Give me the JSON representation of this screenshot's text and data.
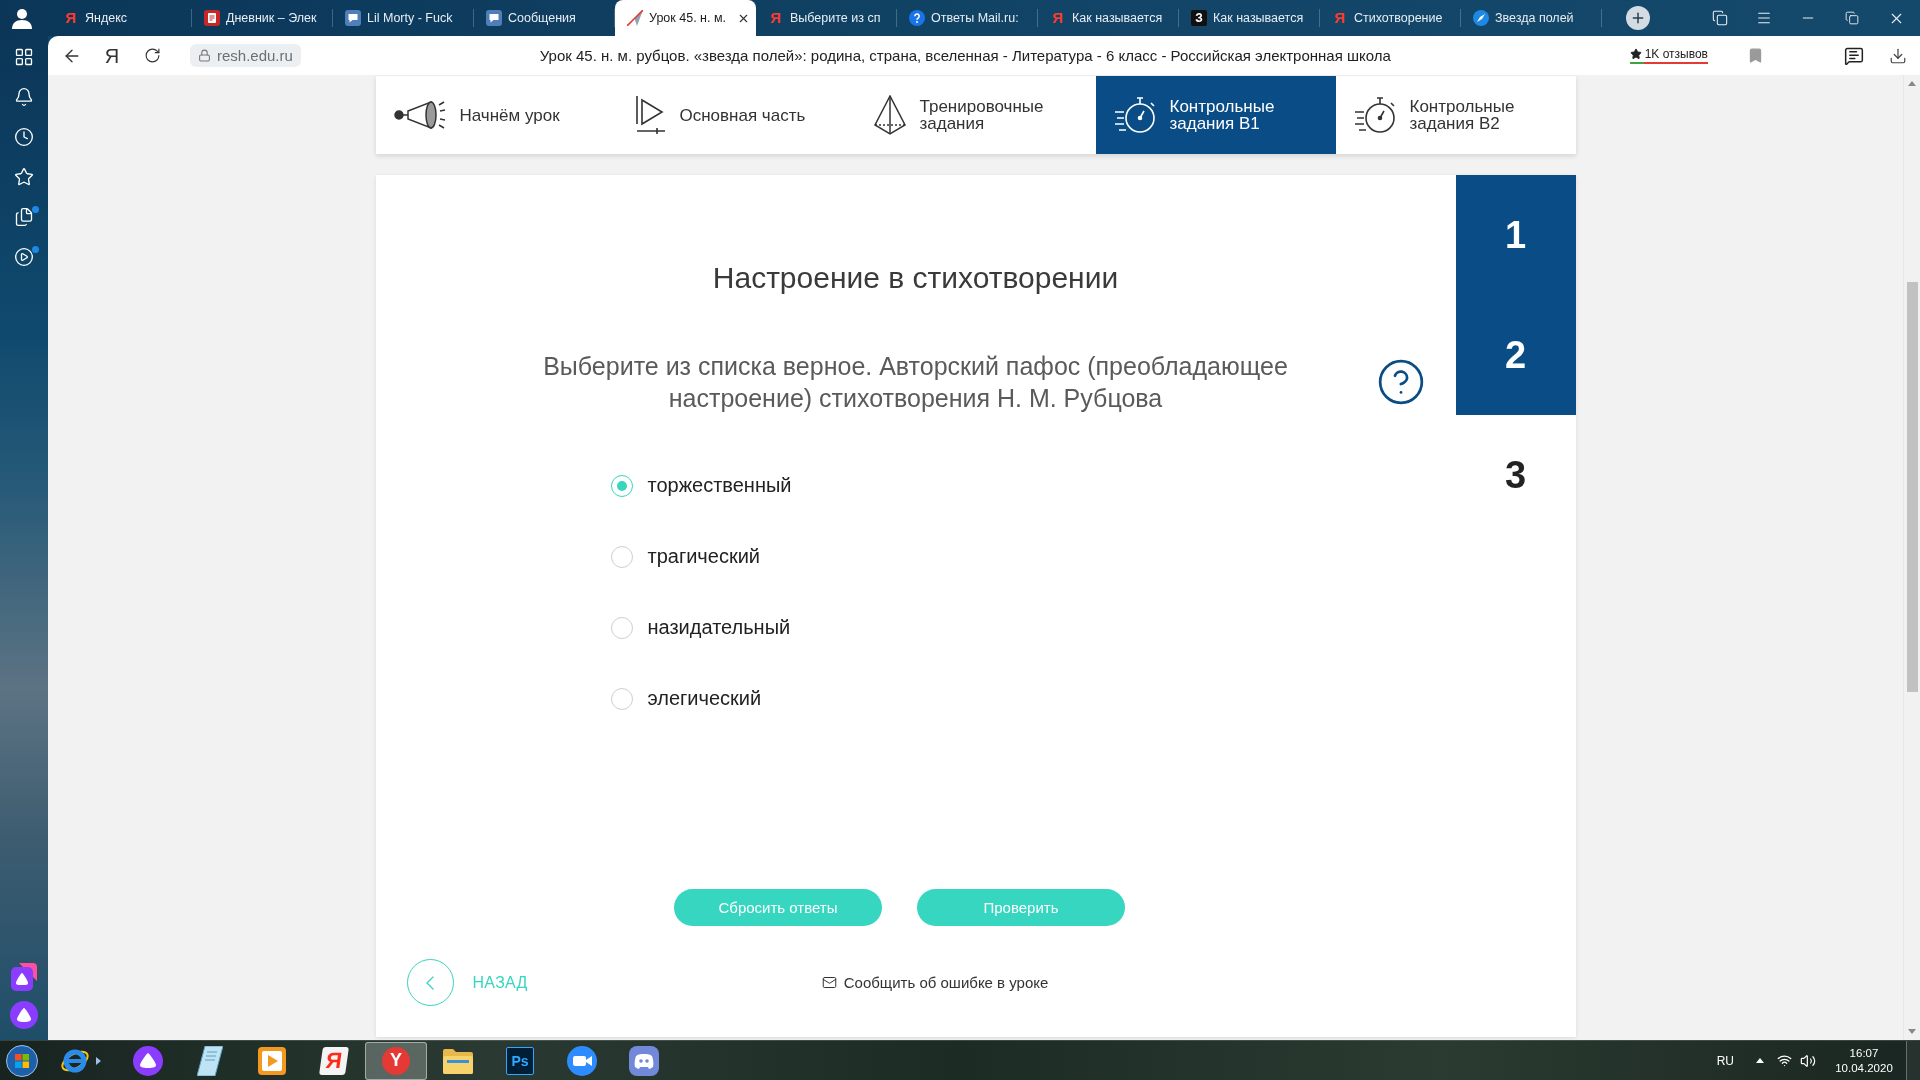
{
  "browser": {
    "tabs": [
      {
        "title": "Яндекс",
        "favicon": {
          "kind": "letter",
          "text": "Я"
        },
        "selected": false
      },
      {
        "title": "Дневник – Элек",
        "favicon": {
          "kind": "document"
        },
        "selected": false
      },
      {
        "title": "Lil Morty - Fuck",
        "favicon": {
          "kind": "chat"
        },
        "selected": false
      },
      {
        "title": "Сообщения",
        "favicon": {
          "kind": "chat"
        },
        "selected": false
      },
      {
        "title": "Урок 45. н. м.",
        "favicon": {
          "kind": "plane"
        },
        "selected": true
      },
      {
        "title": "Выберите из сп",
        "favicon": {
          "kind": "letter",
          "text": "Я"
        },
        "selected": false
      },
      {
        "title": "Ответы Mail.ru:",
        "favicon": {
          "kind": "question"
        },
        "selected": false
      },
      {
        "title": "Как называется",
        "favicon": {
          "kind": "letter",
          "text": "Я"
        },
        "selected": false
      },
      {
        "title": "Как называется",
        "favicon": {
          "kind": "tile",
          "text": "З"
        },
        "selected": false
      },
      {
        "title": "Стихотворение",
        "favicon": {
          "kind": "letter",
          "text": "Я"
        },
        "selected": false
      },
      {
        "title": "Звезда полей",
        "favicon": {
          "kind": "compass"
        },
        "selected": false
      }
    ],
    "address_bar": {
      "logo": "Я",
      "url": "resh.edu.ru",
      "title": "Урок 45. н. м. рубцов. «звезда полей»: родина, страна, вселенная - Литература - 6 класс - Российская электронная школа",
      "reviews": "1K отзывов"
    }
  },
  "sidebar": {
    "items": [
      {
        "kind": "apps",
        "dot": false
      },
      {
        "kind": "bell",
        "dot": false
      },
      {
        "kind": "history",
        "dot": false
      },
      {
        "kind": "star",
        "dot": false
      },
      {
        "kind": "collections",
        "dot": true
      },
      {
        "kind": "video",
        "dot": true
      }
    ],
    "apps": [
      {
        "kind": "tile"
      },
      {
        "kind": "circle"
      }
    ]
  },
  "lesson_nav": {
    "tabs": [
      {
        "label": "Начнём урок",
        "kind": "intro",
        "selected": false
      },
      {
        "label": "Основная часть",
        "kind": "main",
        "selected": false
      },
      {
        "label": "Тренировочные задания",
        "kind": "training",
        "selected": false
      },
      {
        "label": "Контрольные задания В1",
        "kind": "control",
        "selected": true
      },
      {
        "label": "Контрольные задания В2",
        "kind": "control",
        "selected": false
      }
    ]
  },
  "task": {
    "title": "Настроение в стихотворении",
    "question": "Выберите из списка верное. Авторский пафос (преобладающее настроение) стихотворения Н. М. Рубцова",
    "options": [
      {
        "label": "торжественный",
        "selected": true
      },
      {
        "label": "трагический",
        "selected": false
      },
      {
        "label": "назидательный",
        "selected": false
      },
      {
        "label": "элегический",
        "selected": false
      }
    ],
    "buttons": [
      "Сбросить ответы",
      "Проверить"
    ]
  },
  "task_numbers": [
    {
      "number": "1",
      "selected": false
    },
    {
      "number": "2",
      "selected": false
    },
    {
      "number": "3",
      "selected": true
    }
  ],
  "footer": {
    "back": "НАЗАД",
    "report": "Сообщить об ошибке в уроке"
  },
  "taskbar": {
    "apps": [
      {
        "kind": "ie",
        "selected": false
      },
      {
        "kind": "assistant",
        "selected": false
      },
      {
        "kind": "notes",
        "selected": false
      },
      {
        "kind": "media",
        "selected": false
      },
      {
        "kind": "letter",
        "text": "Я",
        "selected": false
      },
      {
        "kind": "round-letter",
        "text": "Y",
        "selected": true
      },
      {
        "kind": "folder",
        "selected": false
      },
      {
        "kind": "tile",
        "text": "Ps",
        "selected": false
      },
      {
        "kind": "video-call",
        "selected": false
      },
      {
        "kind": "chat",
        "selected": false
      }
    ],
    "language": "RU",
    "time": "16:07",
    "date": "10.04.2020"
  }
}
